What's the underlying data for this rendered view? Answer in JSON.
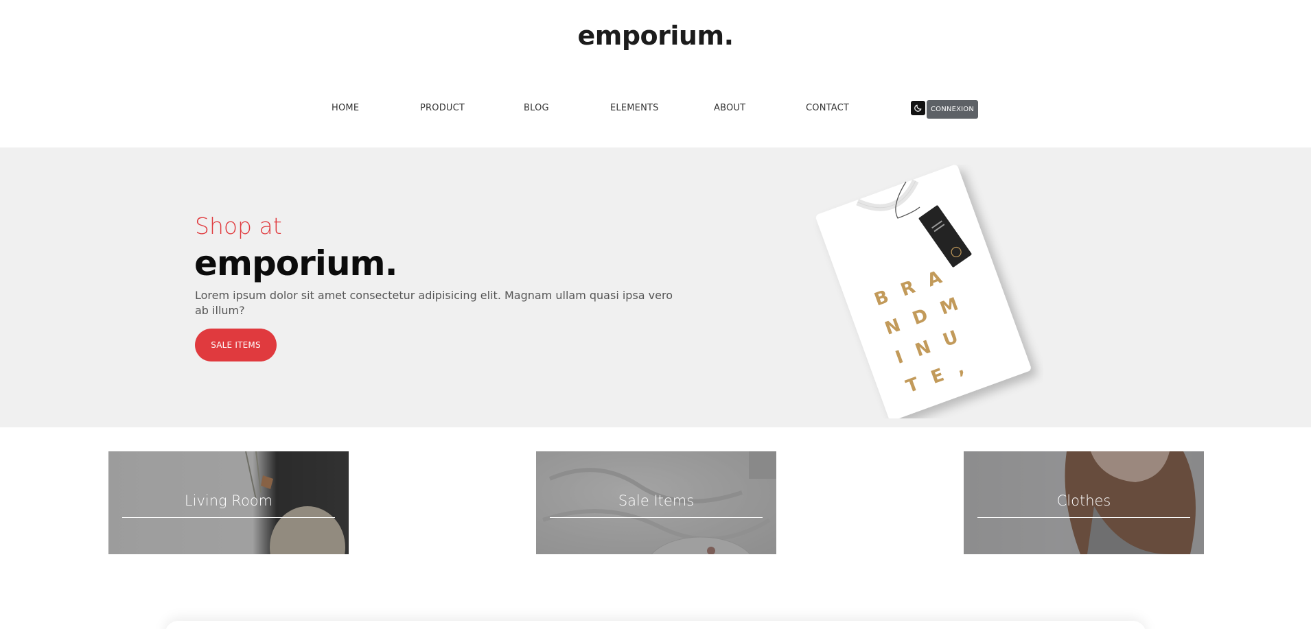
{
  "brand": {
    "logo": "emporium."
  },
  "nav": {
    "items": [
      {
        "label": "HOME"
      },
      {
        "label": "PRODUCT"
      },
      {
        "label": "BLOG"
      },
      {
        "label": "ELEMENTS"
      },
      {
        "label": "ABOUT"
      },
      {
        "label": "CONTACT"
      }
    ],
    "theme_toggle_icon": "moon-icon",
    "connexion_label": "CONNEXION"
  },
  "hero": {
    "kicker": "Shop at",
    "title": "emporium.",
    "description": "Lorem ipsum dolor sit amet consectetur adipisicing elit. Magnam ullam quasi ipsa vero ab illum?",
    "button_label": "SALE ITEMS",
    "accent_color": "#e03a3e",
    "shirt_print": [
      "B R A",
      "N D  M",
      "I  N U",
      "T E ,"
    ]
  },
  "categories": [
    {
      "label": "Living Room"
    },
    {
      "label": "Sale Items"
    },
    {
      "label": "Clothes"
    }
  ]
}
